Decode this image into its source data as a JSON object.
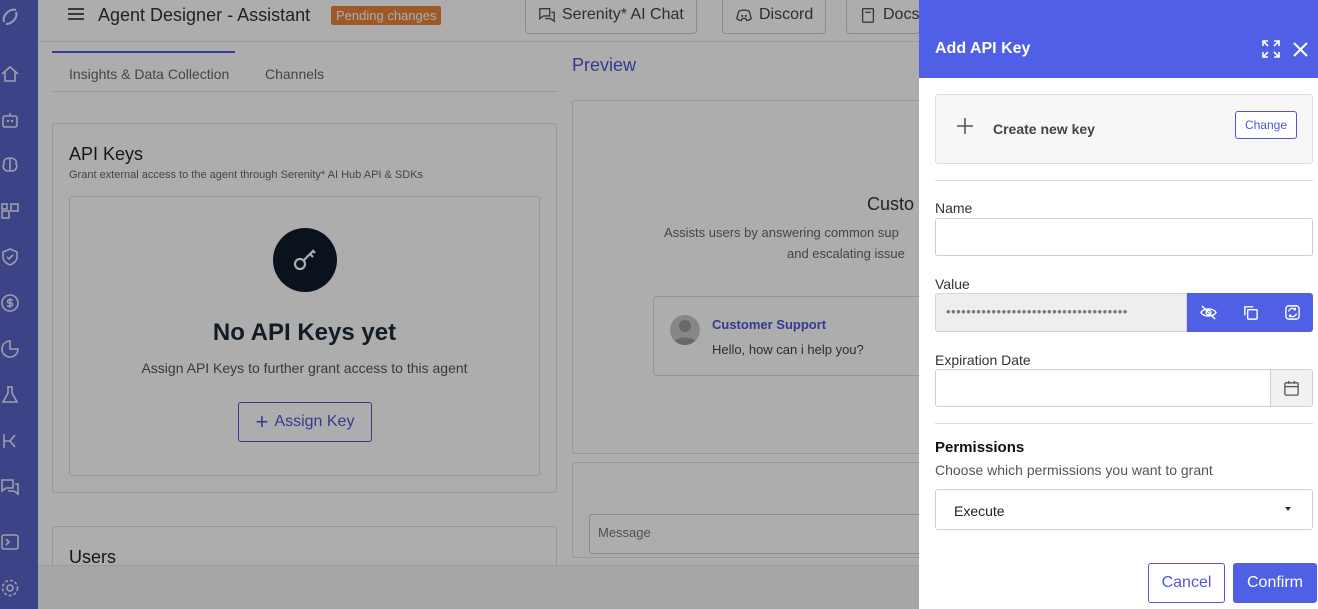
{
  "header": {
    "title": "Agent Designer - Assistant",
    "badge": "Pending changes",
    "buttons": [
      "Serenity* AI Chat",
      "Discord",
      "Docs"
    ]
  },
  "tabs": [
    "Insights & Data Collection",
    "Channels"
  ],
  "api_keys": {
    "title": "API Keys",
    "subtitle": "Grant external access to the agent through Serenity* AI Hub API & SDKs",
    "empty_title": "No API Keys yet",
    "empty_subtitle": "Assign API Keys to further grant access to this agent",
    "assign_label": "Assign Key"
  },
  "users": {
    "title": "Users"
  },
  "preview": {
    "label": "Preview",
    "agent_title": "Custo",
    "description_line1": "Assists users by answering common sup",
    "description_line2": "and escalating issue",
    "chat_name": "Customer Support",
    "chat_message": "Hello, how can i help you?",
    "message_placeholder": "Message"
  },
  "drawer": {
    "title": "Add API Key",
    "create_label": "Create new key",
    "change_label": "Change",
    "name_label": "Name",
    "name_value": "",
    "value_label": "Value",
    "value_masked": "••••••••••••••••••••••••••••••••••••",
    "expiration_label": "Expiration Date",
    "expiration_value": "",
    "permissions_title": "Permissions",
    "permissions_subtitle": "Choose which permissions you want to grant",
    "permissions_value": "Execute",
    "cancel_label": "Cancel",
    "confirm_label": "Confirm"
  },
  "colors": {
    "accent": "#4f5fe6",
    "sidebar": "#5a63c8",
    "badge": "#e8833a"
  }
}
